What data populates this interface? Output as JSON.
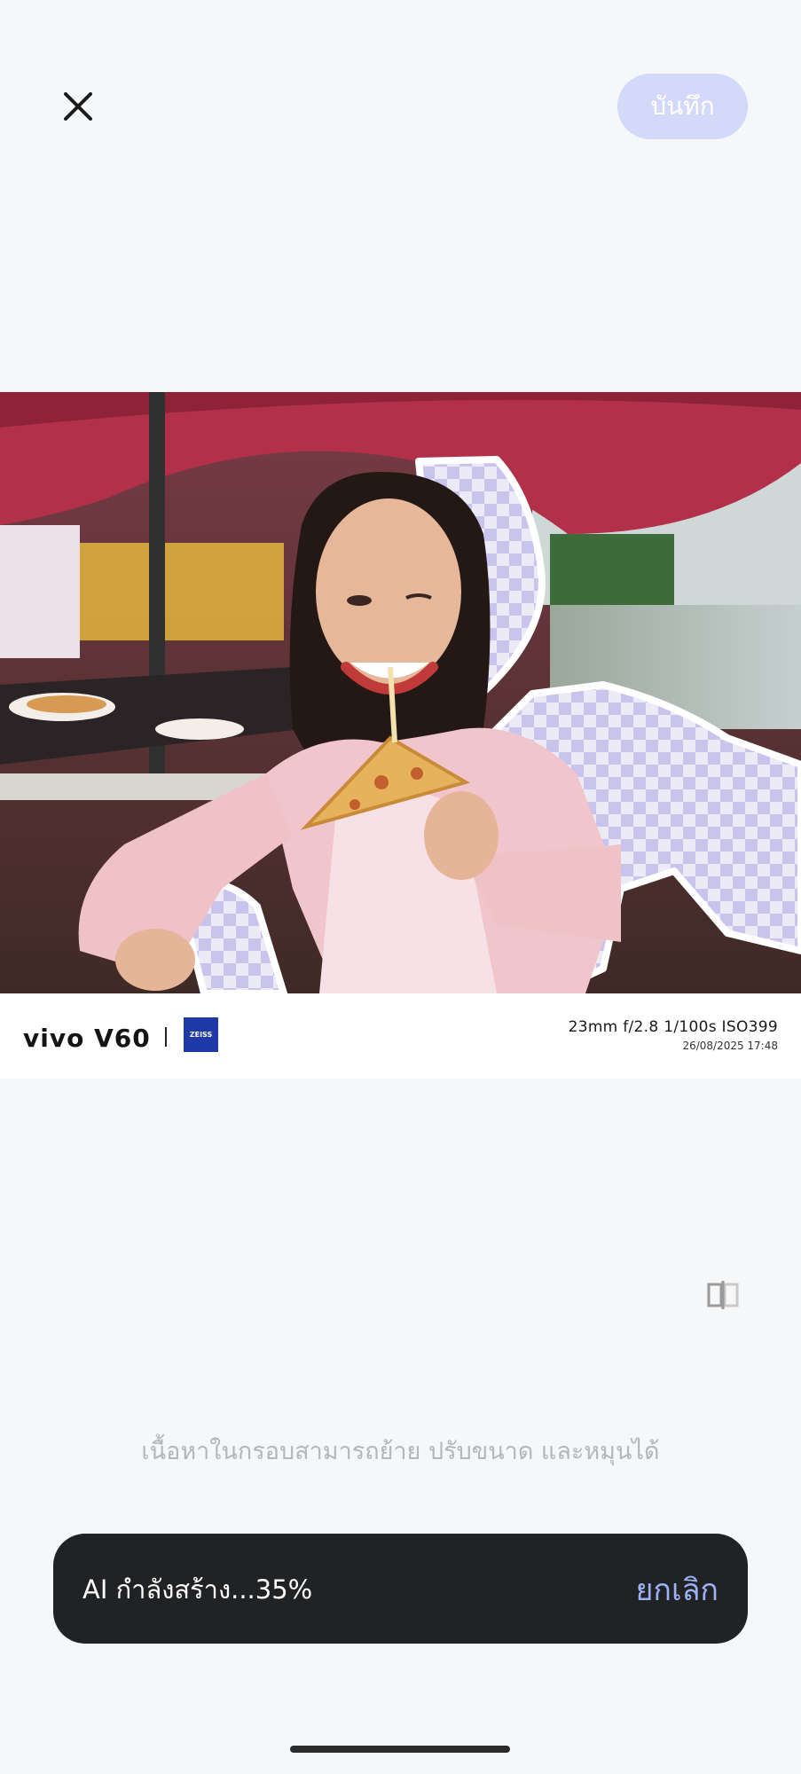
{
  "header": {
    "save_label": "บันทึก"
  },
  "photo": {
    "brand_text": "vivo V60",
    "logo_text": "ZEISS",
    "exif": "23mm  f/2.8  1/100s  ISO399",
    "date": "26/08/2025 17:48"
  },
  "hint": "เนื้อหาในกรอบสามารถย้าย ปรับขนาด และหมุนได้",
  "toast": {
    "status": "AI กำลังสร้าง...35%",
    "progress": 0.35,
    "cancel_label": "ยกเลิก"
  },
  "icons": {
    "close": "close-icon",
    "compare": "compare-icon"
  },
  "colors": {
    "accent": "#9db1f6",
    "save_disabled": "#d3d9f9",
    "toast_bg": "#212224"
  }
}
